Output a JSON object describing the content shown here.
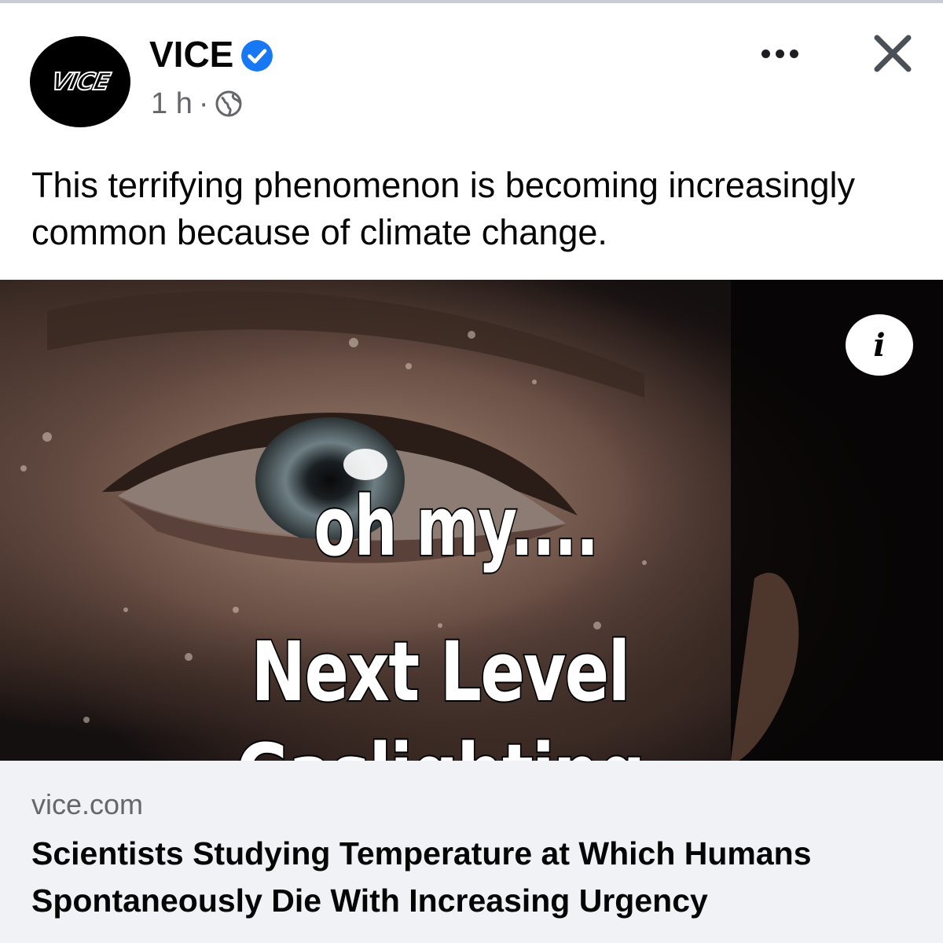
{
  "post": {
    "page_name": "VICE",
    "avatar_logo_text": "VICE",
    "timestamp": "1 h",
    "separator": "·",
    "privacy_icon": "globe-icon",
    "verified_icon": "verified-badge-icon",
    "caption": "This terrifying phenomenon is becoming increasingly common because of climate change."
  },
  "image": {
    "overlay_line1": "oh my....",
    "overlay_line2": "Next Level Gaslighting",
    "info_label": "i"
  },
  "link": {
    "domain": "vice.com",
    "title": "Scientists Studying Temperature at Which Humans Spontaneously Die With Increasing Urgency"
  },
  "colors": {
    "verified_blue": "#1877f2",
    "secondary_text": "#65676b",
    "link_bg": "#f0f2f5"
  },
  "icons": {
    "more": "more-options-icon",
    "close": "close-icon",
    "info": "info-icon"
  }
}
